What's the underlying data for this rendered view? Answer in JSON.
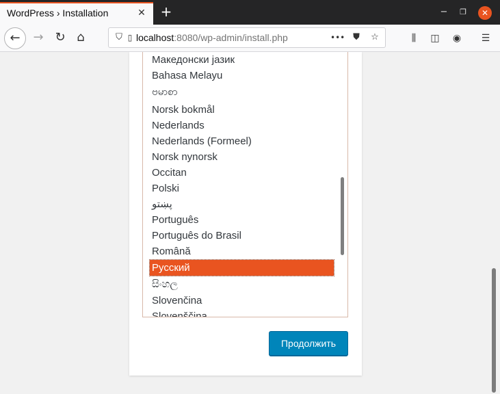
{
  "browser": {
    "tab_title": "WordPress › Installation",
    "url_host": "localhost",
    "url_rest": ":8080/wp-admin/install.php",
    "menu_dots": "•••"
  },
  "language_list": {
    "items": [
      "Македонски јазик",
      "Bahasa Melayu",
      "ဗမာစာ",
      "Norsk bokmål",
      "Nederlands",
      "Nederlands (Formeel)",
      "Norsk nynorsk",
      "Occitan",
      "Polski",
      "پښتو",
      "Português",
      "Português do Brasil",
      "Română",
      "Русский",
      "සිංහල",
      "Slovenčina",
      "Slovenščina"
    ],
    "selected": "Русский"
  },
  "continue_label": "Продолжить",
  "colors": {
    "accent": "#e95420",
    "button": "#0085ba"
  }
}
